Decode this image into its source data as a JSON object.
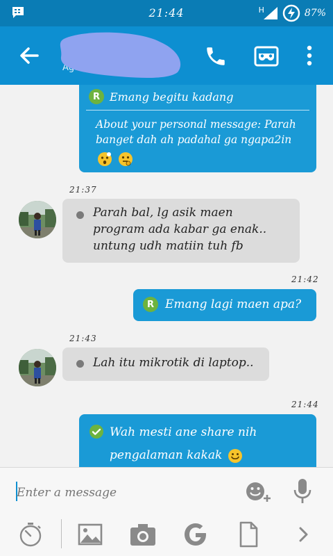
{
  "status_bar": {
    "time": "21:44",
    "network": "H",
    "battery_percent": "87%",
    "icons": [
      "bbm-notification-icon",
      "signal-icon",
      "battery-saver-icon"
    ]
  },
  "app_bar": {
    "contact_name": "Agung Wijaya (...",
    "icons": [
      "back-arrow-icon",
      "phone-icon",
      "mask-icon",
      "more-vert-icon"
    ]
  },
  "messages": [
    {
      "direction": "outgoing",
      "badge": "R",
      "quote": "Emang begitu kadang",
      "text_line1": "About your personal message: Parah",
      "text_line2": "banget dah ah padahal ga ngapa2in",
      "emoji": [
        "shocked-face-icon",
        "thinking-face-icon"
      ]
    },
    {
      "direction": "incoming",
      "time": "21:37",
      "line1": "Parah bal, lg asik maen",
      "line2": "program ada kabar ga enak..",
      "line3": "untung udh matiin tuh fb"
    },
    {
      "direction": "outgoing",
      "time": "21:42",
      "badge": "R",
      "text": "Emang lagi maen apa?"
    },
    {
      "direction": "incoming",
      "time": "21:43",
      "text": "Lah itu mikrotik di laptop.."
    },
    {
      "direction": "outgoing",
      "time": "21:44",
      "line1": "Wah mesti ane share nih",
      "line2": "pengalaman kakak",
      "emoji": "smile-face-icon"
    }
  ],
  "composer": {
    "placeholder": "Enter a message"
  },
  "toolbar_icons": [
    "timer-icon",
    "image-icon",
    "camera-icon",
    "google-icon",
    "file-icon",
    "chevron-right-icon"
  ],
  "colors": {
    "status_bar": "#0a7cb5",
    "app_bar": "#0d8fd1",
    "outgoing_bubble": "#1a9ad6",
    "incoming_bubble": "#dcdcdc",
    "badge_green": "#6db33f"
  }
}
